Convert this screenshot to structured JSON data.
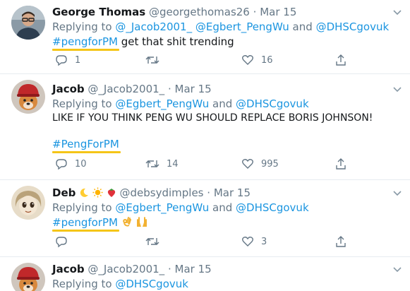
{
  "tweets": [
    {
      "name": "George Thomas",
      "handle": "@georgethomas26",
      "dot": "·",
      "date": "Mar 15",
      "replying_prefix": "Replying to",
      "mentions": [
        "@_Jacob2001_",
        "@Egbert_PengWu",
        "@DHSCgovuk"
      ],
      "conj": "and",
      "hashtag": "#pengforPM",
      "text": "get that shit trending",
      "replies": "1",
      "retweets": "",
      "likes": "16",
      "avatar_icon": "person-with-glasses-photo"
    },
    {
      "name": "Jacob",
      "handle": "@_Jacob2001_",
      "dot": "·",
      "date": "Mar 15",
      "replying_prefix": "Replying to",
      "mentions": [
        "@Egbert_PengWu",
        "@DHSCgovuk"
      ],
      "conj": "and",
      "text": "LIKE IF YOU THINK PENG WU SHOULD REPLACE BORIS JOHNSON!",
      "hashtag": "#PengForPM",
      "replies": "10",
      "retweets": "14",
      "likes": "995",
      "avatar_icon": "dog-in-hat-photo"
    },
    {
      "name": "Deb",
      "name_emoji": [
        "crescent-moon-icon",
        "sun-icon",
        "strawberry-icon"
      ],
      "handle": "@debsydimples",
      "dot": "·",
      "date": "Mar 15",
      "replying_prefix": "Replying to",
      "mentions": [
        "@Egbert_PengWu",
        "@DHSCgovuk"
      ],
      "conj": "and",
      "hashtag": "#pengforPM",
      "hashtag_emoji": [
        "ok-hand-icon",
        "raised-hands-icon"
      ],
      "replies": "",
      "retweets": "",
      "likes": "3",
      "avatar_icon": "cartoon-character-photo"
    },
    {
      "name": "Jacob",
      "handle": "@_Jacob2001_",
      "dot": "·",
      "date": "Mar 15",
      "replying_prefix": "Replying to",
      "mentions": [
        "@DHSCgovuk"
      ],
      "avatar_icon": "dog-in-hat-photo"
    }
  ],
  "colors": {
    "link": "#1b95e0",
    "secondary": "#657786",
    "highlight_underline": "#f5c518",
    "separator": "#e6ecf0"
  }
}
